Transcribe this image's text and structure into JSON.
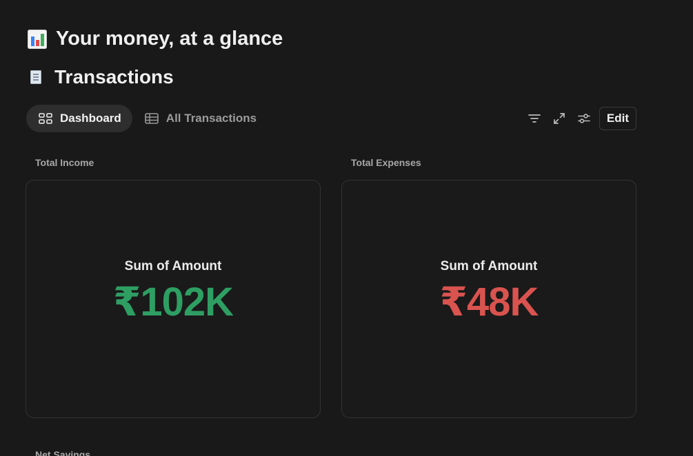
{
  "headings": {
    "overview_title": "Your money, at a glance",
    "database_title": "Transactions"
  },
  "icons": {
    "overview": "bar-chart-emoji",
    "database": "receipt-emoji",
    "dashboard_tab": "dashboard-grid-icon",
    "all_transactions_tab": "table-icon",
    "filter": "filter-icon",
    "expand": "expand-icon",
    "settings": "sliders-icon"
  },
  "views": {
    "tabs": [
      {
        "label": "Dashboard",
        "active": true
      },
      {
        "label": "All Transactions",
        "active": false
      }
    ]
  },
  "toolbar": {
    "edit_label": "Edit"
  },
  "cards": [
    {
      "label": "Total Income",
      "metric": "Sum of Amount",
      "value": "₹102K",
      "value_color": "#2e9e63"
    },
    {
      "label": "Total Expenses",
      "metric": "Sum of Amount",
      "value": "₹48K",
      "value_color": "#d9534f"
    }
  ],
  "next_section": {
    "label_partial": "Net Savings"
  },
  "colors": {
    "background": "#191919",
    "income": "#2e9e63",
    "expense": "#d9534f",
    "card_border": "#333333"
  }
}
